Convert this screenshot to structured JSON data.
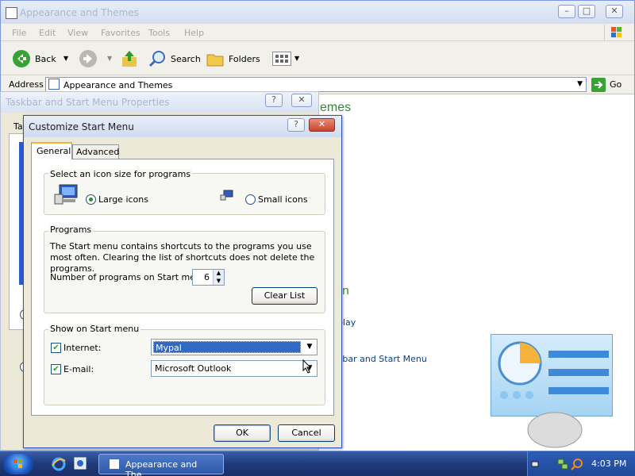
{
  "explorer": {
    "title": "Appearance and Themes",
    "menu": [
      "File",
      "Edit",
      "View",
      "Favorites",
      "Tools",
      "Help"
    ],
    "toolbar": {
      "back": "Back",
      "search": "Search",
      "folders": "Folders"
    },
    "address": {
      "label": "Address",
      "value": "Appearance and Themes",
      "go": "Go"
    },
    "content": {
      "heading_fragment": "emes",
      "section_fragment": "n",
      "task_fragment_1": "play",
      "task_fragment_2": "kbar and Start Menu"
    }
  },
  "taskbar_properties": {
    "title": "Taskbar and Start Menu Properties",
    "tab_fragment": "Ta"
  },
  "customize": {
    "title": "Customize Start Menu",
    "tabs": [
      "General",
      "Advanced"
    ],
    "icon_size": {
      "group_label": "Select an icon size for programs",
      "large": "Large icons",
      "small": "Small icons",
      "selected": "large"
    },
    "programs": {
      "group_label": "Programs",
      "description": "The Start menu contains shortcuts to the programs you use most often. Clearing the list of shortcuts does not delete the programs.",
      "count_label": "Number of programs on Start menu:",
      "count_value": "6",
      "clear_button": "Clear List"
    },
    "show_on_start": {
      "group_label": "Show on Start menu",
      "internet_label": "Internet:",
      "internet_checked": true,
      "internet_value": "Mypal",
      "email_label": "E-mail:",
      "email_checked": true,
      "email_value": "Microsoft Outlook"
    },
    "ok": "OK",
    "cancel": "Cancel"
  },
  "taskbar": {
    "task_button": "Appearance and The...",
    "clock": "4:03 PM"
  },
  "colors": {
    "selection": "#316ac5",
    "link": "#0b3f8e",
    "heading": "#2e8b2e"
  }
}
